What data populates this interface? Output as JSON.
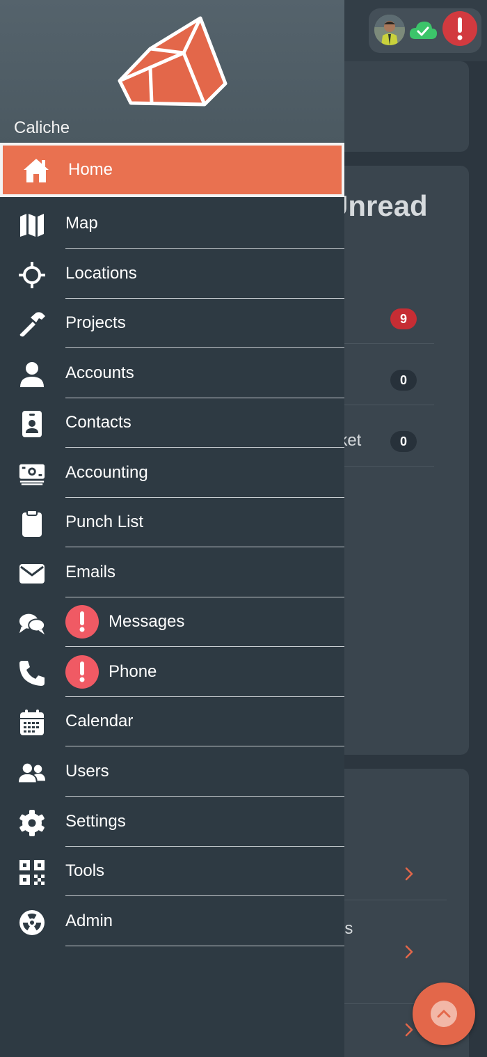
{
  "header": {
    "org_name": "Caliche",
    "status": {
      "avatar": "user-avatar",
      "cloud": "cloud-check-icon",
      "alert": "alert-icon"
    }
  },
  "colors": {
    "accent": "#e97150",
    "drawer_bg": "#2e3a43",
    "alert": "#f05a64",
    "sync_ok": "#3cc46a"
  },
  "nav": {
    "items": [
      {
        "label": "Home",
        "icon": "home-icon",
        "active": true
      },
      {
        "label": "Map",
        "icon": "map-icon"
      },
      {
        "label": "Locations",
        "icon": "crosshair-icon"
      },
      {
        "label": "Projects",
        "icon": "hammer-icon"
      },
      {
        "label": "Accounts",
        "icon": "user-icon"
      },
      {
        "label": "Contacts",
        "icon": "id-badge-icon"
      },
      {
        "label": "Accounting",
        "icon": "money-icon"
      },
      {
        "label": "Punch List",
        "icon": "clipboard-icon"
      },
      {
        "label": "Emails",
        "icon": "envelope-icon"
      },
      {
        "label": "Messages",
        "icon": "chat-icon",
        "alert": true
      },
      {
        "label": "Phone",
        "icon": "phone-icon",
        "alert": true
      },
      {
        "label": "Calendar",
        "icon": "calendar-icon"
      },
      {
        "label": "Users",
        "icon": "users-icon"
      },
      {
        "label": "Settings",
        "icon": "gear-icon"
      },
      {
        "label": "Tools",
        "icon": "qrcode-icon"
      },
      {
        "label": "Admin",
        "icon": "radiation-icon"
      }
    ]
  },
  "background": {
    "unread_title": "Unread",
    "counts": [
      "9",
      "0",
      "0"
    ],
    "partial_ticket": "icket",
    "partial_ess": "ess"
  }
}
